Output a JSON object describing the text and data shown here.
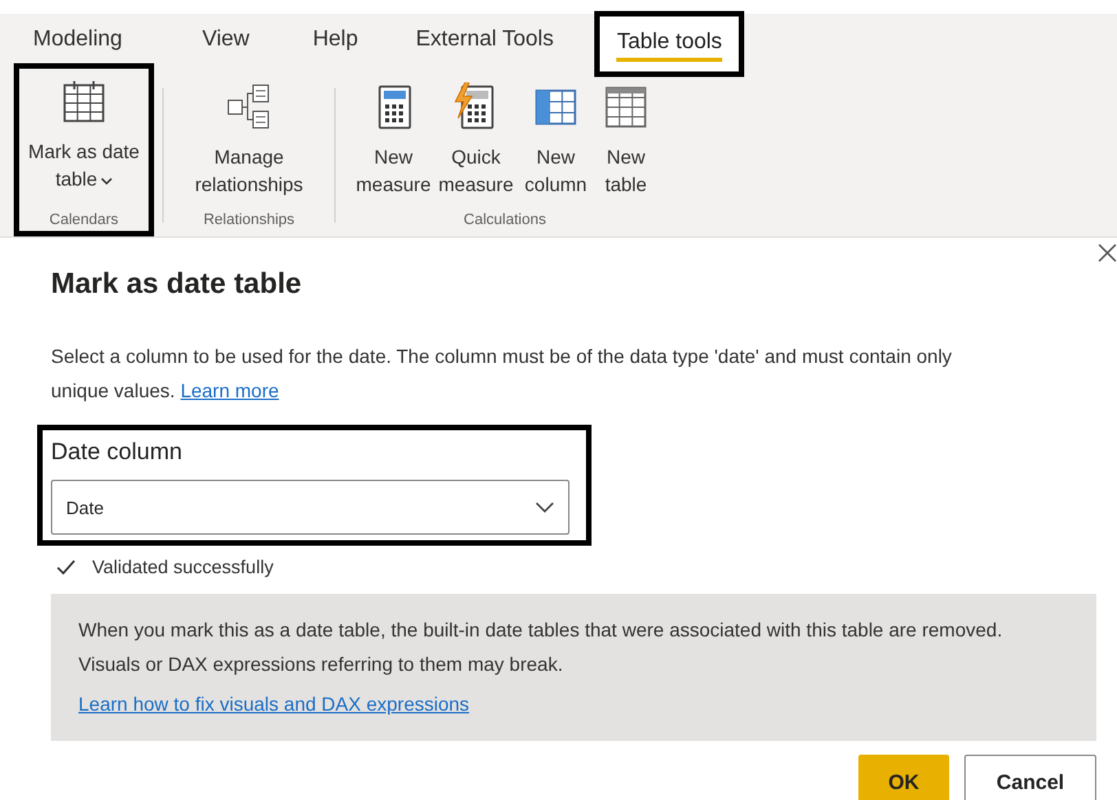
{
  "tabs": [
    {
      "label": "Modeling",
      "selected": false,
      "highlighted": false
    },
    {
      "label": "View",
      "selected": false,
      "highlighted": false
    },
    {
      "label": "Help",
      "selected": false,
      "highlighted": false
    },
    {
      "label": "External Tools",
      "selected": false,
      "highlighted": false
    },
    {
      "label": "Table tools",
      "selected": true,
      "highlighted": true
    }
  ],
  "ribbon": {
    "groups": [
      {
        "label": "Calendars",
        "highlighted": true,
        "items": [
          {
            "kind": "calendar",
            "label": "Mark as date table",
            "dropdown": true
          }
        ]
      },
      {
        "label": "Relationships",
        "highlighted": false,
        "items": [
          {
            "kind": "relationships",
            "label": "Manage relationships",
            "dropdown": false
          }
        ]
      },
      {
        "label": "Calculations",
        "highlighted": false,
        "items": [
          {
            "kind": "calculator",
            "label": "New measure",
            "dropdown": false
          },
          {
            "kind": "quick-calculator",
            "label": "Quick measure",
            "dropdown": false
          },
          {
            "kind": "column-table",
            "label": "New column",
            "dropdown": false
          },
          {
            "kind": "table",
            "label": "New table",
            "dropdown": false
          }
        ]
      }
    ]
  },
  "dialog": {
    "title": "Mark as date table",
    "description": "Select a column to be used for the date. The column must be of the data type 'date' and must contain only unique values.",
    "description_link": "Learn more",
    "field": {
      "label": "Date column",
      "value": "Date",
      "highlighted": true
    },
    "validation": {
      "text": "Validated successfully",
      "valid": true
    },
    "notice": {
      "text": "When you mark this as a date table, the built-in date tables that were associated with this table are removed. Visuals or DAX expressions referring to them may break.",
      "link": "Learn how to fix visuals and DAX expressions"
    },
    "buttons": [
      {
        "label": "OK",
        "primary": true
      },
      {
        "label": "Cancel",
        "primary": false
      }
    ]
  }
}
